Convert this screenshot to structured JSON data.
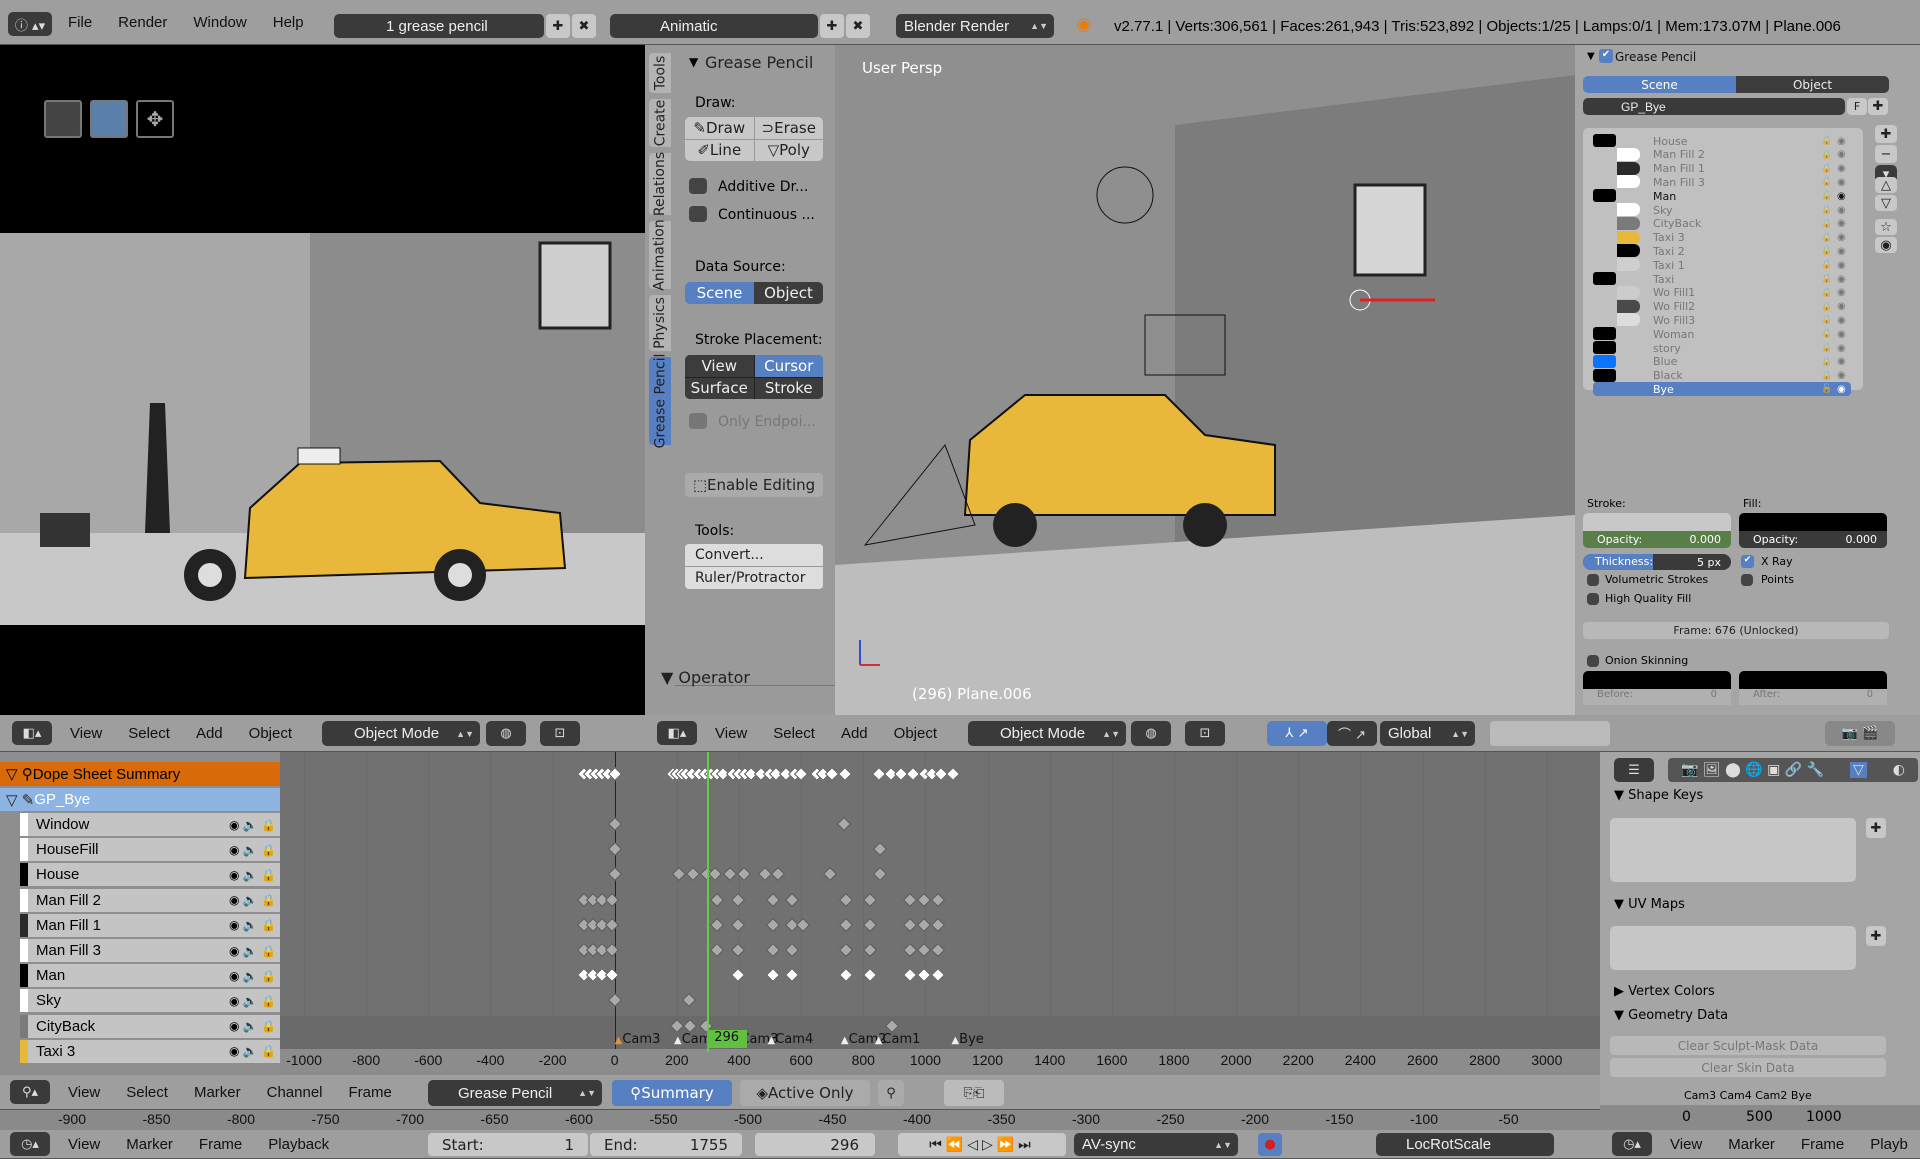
{
  "topbar": {
    "menus": [
      "File",
      "Render",
      "Window",
      "Help"
    ],
    "screen_layout": "1 grease pencil",
    "scene": "Animatic",
    "engine": "Blender Render",
    "stats": "v2.77.1 | Verts:306,561 | Faces:261,943 | Tris:523,892 | Objects:1/25 | Lamps:0/1 | Mem:173.07M | Plane.006"
  },
  "toolshelf": {
    "tabs": [
      "Tools",
      "Create",
      "Relations",
      "Animation",
      "Physics",
      "Grease Pencil"
    ],
    "active_tab": "Grease Pencil",
    "panel_title": "Grease Pencil",
    "draw_label": "Draw:",
    "draw_buttons": [
      "Draw",
      "Erase",
      "Line",
      "Poly"
    ],
    "checkboxes": [
      "Additive Dr...",
      "Continuous ..."
    ],
    "data_source_label": "Data Source:",
    "data_source": [
      "Scene",
      "Object"
    ],
    "data_source_active": "Scene",
    "stroke_placement_label": "Stroke Placement:",
    "stroke_placement": [
      "View",
      "Cursor",
      "Surface",
      "Stroke"
    ],
    "stroke_placement_active": "Cursor",
    "only_endpoints": "Only Endpoi...",
    "enable_editing": "Enable Editing",
    "tools_label": "Tools:",
    "tools": [
      "Convert...",
      "Ruler/Protractor"
    ],
    "operator": "Operator"
  },
  "viewport": {
    "view_label": "User Persp",
    "object_label": "(296) Plane.006"
  },
  "properties": {
    "panel_title": "Grease Pencil",
    "tabs": [
      "Scene",
      "Object"
    ],
    "active_tab": "Scene",
    "gp_name": "GP_Bye",
    "fake_user": "F",
    "layers": [
      {
        "name": "House",
        "stroke": "#000000",
        "fill": null
      },
      {
        "name": "Man Fill 2",
        "stroke": null,
        "fill": "#ffffff"
      },
      {
        "name": "Man Fill 1",
        "stroke": null,
        "fill": "#2a2a2a"
      },
      {
        "name": "Man Fill 3",
        "stroke": null,
        "fill": "#ffffff"
      },
      {
        "name": "Man",
        "stroke": "#000000",
        "fill": null,
        "unlocked": true
      },
      {
        "name": "Sky",
        "stroke": null,
        "fill": "#ffffff"
      },
      {
        "name": "CityBack",
        "stroke": null,
        "fill": "#7a7a7a"
      },
      {
        "name": "Taxi 3",
        "stroke": null,
        "fill": "#e8b838"
      },
      {
        "name": "Taxi 2",
        "stroke": null,
        "fill": "#000000"
      },
      {
        "name": "Taxi 1",
        "stroke": null,
        "fill": "#cfcfcf"
      },
      {
        "name": "Taxi",
        "stroke": "#000000",
        "fill": null
      },
      {
        "name": "Wo Fill1",
        "stroke": null,
        "fill": "#cccccc"
      },
      {
        "name": "Wo Fill2",
        "stroke": null,
        "fill": "#4a4a4a"
      },
      {
        "name": "Wo Fill3",
        "stroke": null,
        "fill": "#dddddd"
      },
      {
        "name": "Woman",
        "stroke": "#000000",
        "fill": null
      },
      {
        "name": "story",
        "stroke": "#000000",
        "fill": null
      },
      {
        "name": "Blue",
        "stroke": "#0a74ff",
        "fill": null
      },
      {
        "name": "Black",
        "stroke": "#000000",
        "fill": null
      },
      {
        "name": "Bye",
        "stroke": null,
        "fill": null,
        "selected": true,
        "unlocked": true
      }
    ],
    "stroke_label": "Stroke:",
    "fill_label": "Fill:",
    "opacity_label": "Opacity:",
    "stroke_opacity": "0.000",
    "fill_opacity": "0.000",
    "thickness_label": "Thickness:",
    "thickness": "5 px",
    "volumetric": "Volumetric Strokes",
    "xray": "X Ray",
    "points": "Points",
    "hq_fill": "High Quality Fill",
    "frame": "Frame: 676 (Unlocked)",
    "onion": "Onion Skinning",
    "before_label": "Before:",
    "before": "0",
    "after_label": "After:",
    "after": "0"
  },
  "view_headers": {
    "menus": [
      "View",
      "Select",
      "Add",
      "Object"
    ],
    "mode": "Object Mode",
    "orientation": "Global"
  },
  "dopesheet": {
    "summary": "Dope Sheet Summary",
    "gp": "GP_Bye",
    "current_frame": "296",
    "accent": "#d86a0a",
    "channels": [
      {
        "name": "Window",
        "color": "#ffffff"
      },
      {
        "name": "HouseFill",
        "color": "#ffffff"
      },
      {
        "name": "House",
        "color": "#000000"
      },
      {
        "name": "Man Fill 2",
        "color": "#ffffff"
      },
      {
        "name": "Man Fill 1",
        "color": "#2a2a2a"
      },
      {
        "name": "Man Fill 3",
        "color": "#ffffff"
      },
      {
        "name": "Man",
        "color": "#000000"
      },
      {
        "name": "Sky",
        "color": "#ffffff"
      },
      {
        "name": "CityBack",
        "color": "#7a7a7a"
      },
      {
        "name": "Taxi 3",
        "color": "#e8b838"
      }
    ],
    "keyframes": {
      "summary": [
        -100,
        -80,
        -60,
        -40,
        -20,
        0,
        189,
        200,
        215,
        230,
        250,
        270,
        290,
        310,
        330,
        350,
        380,
        400,
        420,
        440,
        470,
        500,
        520,
        550,
        580,
        600,
        650,
        670,
        700,
        740,
        850,
        890,
        920,
        960,
        1000,
        1020,
        1050,
        1090
      ],
      "rows": [
        [
          0,
          738
        ],
        [
          0,
          853
        ],
        [
          0,
          207,
          252,
          297,
          324,
          371,
          416,
          484,
          525,
          693,
          853
        ],
        [
          -100,
          -70,
          -40,
          -10,
          328,
          396,
          508,
          570,
          744,
          822,
          949,
          996,
          1041
        ],
        [
          -100,
          -70,
          -40,
          -10,
          328,
          396,
          508,
          570,
          607,
          744,
          822,
          949,
          996,
          1041
        ],
        [
          -100,
          -70,
          -40,
          -10,
          328,
          396,
          508,
          570,
          744,
          822,
          949,
          996,
          1041
        ],
        [
          -100,
          -70,
          -40,
          -10,
          396,
          508,
          570,
          744,
          822,
          949,
          996,
          1041
        ],
        [
          0,
          238
        ],
        [
          201,
          242,
          293,
          894
        ],
        []
      ]
    },
    "markers": [
      {
        "name": "Cam3",
        "frame": 16
      },
      {
        "name": "Cam2",
        "frame": 207
      },
      {
        "name": "Cam3",
        "frame": 396
      },
      {
        "name": "Cam4",
        "frame": 508
      },
      {
        "name": "Cam2",
        "frame": 744
      },
      {
        "name": "Cam1",
        "frame": 853
      },
      {
        "name": "Bye",
        "frame": 1100
      }
    ],
    "ticks": [
      -1000,
      -800,
      -600,
      -400,
      -200,
      0,
      200,
      400,
      600,
      800,
      1000,
      1200,
      1400,
      1600,
      1800,
      2000,
      2200,
      2400,
      2600,
      2800,
      3000
    ]
  },
  "dope_header": {
    "menus": [
      "View",
      "Select",
      "Marker",
      "Channel",
      "Frame"
    ],
    "mode": "Grease Pencil",
    "summary": "Summary",
    "active_only": "Active Only"
  },
  "ruler_ticks": [
    "-900",
    "-850",
    "-800",
    "-750",
    "-700",
    "-650",
    "-600",
    "-550",
    "-500",
    "-450",
    "-400",
    "-350",
    "-300",
    "-250",
    "-200",
    "-150",
    "-100",
    "-50"
  ],
  "timeline": {
    "menus": [
      "View",
      "Marker",
      "Frame",
      "Playback"
    ],
    "start_label": "Start:",
    "start": "1",
    "end_label": "End:",
    "end": "1755",
    "frame": "296",
    "sync": "AV-sync",
    "keying_set": "LocRotScale",
    "right_menus": [
      "View",
      "Marker",
      "Frame",
      "Playb"
    ]
  },
  "props_lower": {
    "panels": [
      "Shape Keys",
      "UV Maps",
      "Vertex Colors",
      "Geometry Data"
    ],
    "buttons": [
      "Clear Sculpt-Mask Data",
      "Clear Skin Data"
    ],
    "mini_ticks": [
      "0",
      "500",
      "1000"
    ],
    "mini_markers": "Cam3  Cam4  Cam2 Bye"
  }
}
